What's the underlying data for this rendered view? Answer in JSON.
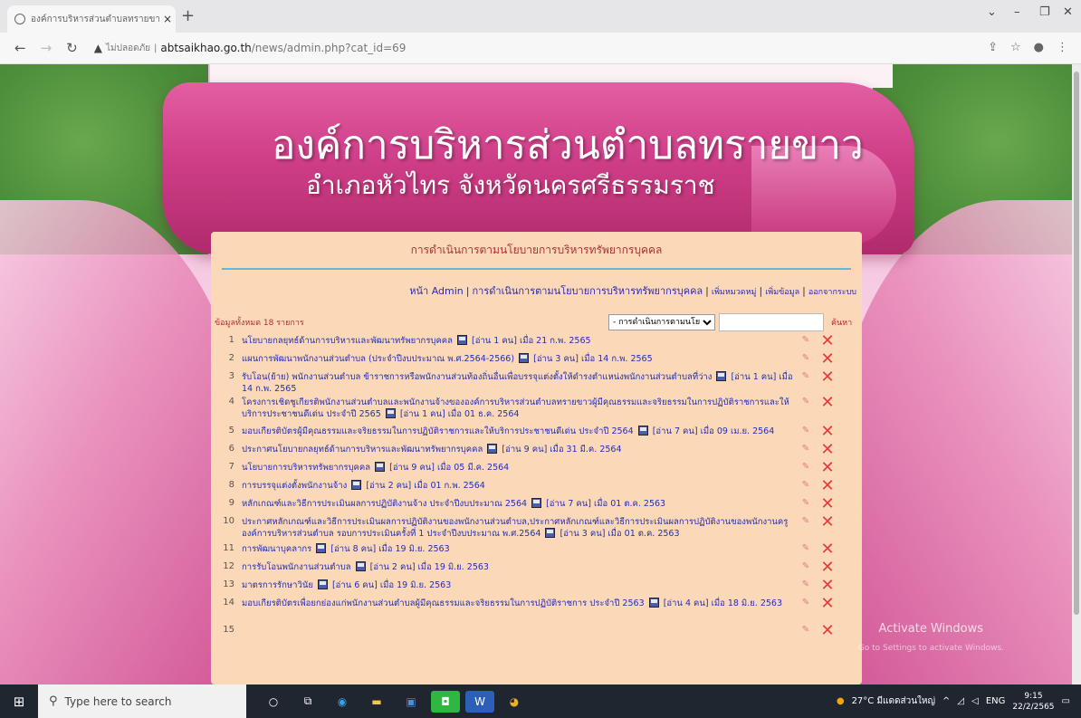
{
  "browser": {
    "tab_title": "องค์การบริหารส่วนตำบลทรายขาว อ.",
    "tab_close": "×",
    "new_tab": "+",
    "not_secure": "ไม่ปลอดภัย",
    "url_domain": "abtsaikhao.go.th",
    "url_path": "/news/admin.php?cat_id=69"
  },
  "header": {
    "org_name": "องค์การบริหารส่วนตำบลทรายขาว",
    "org_location": "อำเภอหัวไทร จังหวัดนครศรีธรรมราช"
  },
  "panel": {
    "title": "การดำเนินการตามนโยบายการบริหารทรัพยากรบุคคล",
    "nav": {
      "admin_home": "หน้า Admin",
      "category": "การดำเนินการตามนโยบายการบริหารทรัพยากรบุคคล",
      "add_category": "เพิ่มหมวดหมู่",
      "add_item": "เพิ่มข้อมูล",
      "logout": "ออกจากระบบ"
    },
    "total": "ข้อมูลทั้งหมด 18 รายการ",
    "category_select": "- การดำเนินการตามนโย",
    "search_value": "",
    "search_button": "ค้นหา",
    "items": [
      {
        "num": "1",
        "title": "นโยบายกลยุทธ์ด้านการบริหารและพัฒนาทรัพยากรบุคคล",
        "read": "[อ่าน 1 คน] เมื่อ 21 ก.พ. 2565"
      },
      {
        "num": "2",
        "title": "แผนการพัฒนาพนักงานส่วนตำบล (ประจำปีงบประมาณ พ.ศ.2564-2566)",
        "read": "[อ่าน 3 คน] เมื่อ 14 ก.พ. 2565"
      },
      {
        "num": "3",
        "title": "รับโอน(ย้าย) พนักงานส่วนตำบล ข้าราชการหรือพนักงานส่วนท้องถิ่นอื่นเพื่อบรรจุแต่งตั้งให้ดำรงตำแหน่งพนักงานส่วนตำบลที่ว่าง",
        "read": "[อ่าน 1 คน] เมื่อ 14 ก.พ. 2565"
      },
      {
        "num": "4",
        "title": "โครงการเชิดชูเกียรติพนักงานส่วนตำบลและพนักงานจ้างขององค์การบริหารส่วนตำบลทรายขาวผู้มีคุณธรรมและจริยธรรมในการปฏิบัติราชการและให้บริการประชาชนดีเด่น ประจำปี 2565",
        "read": "[อ่าน 1 คน] เมื่อ 01 ธ.ค. 2564"
      },
      {
        "num": "5",
        "title": "มอบเกียรติบัตรผู้มีคุณธรรมและจริยธรรมในการปฏิบัติราชการและให้บริการประชาชนดีเด่น ประจำปี 2564",
        "read": "[อ่าน 7 คน] เมื่อ 09 เม.ย. 2564"
      },
      {
        "num": "6",
        "title": "ประกาศนโยบายกลยุทธ์ด้านการบริหารและพัฒนาทรัพยากรบุคคล",
        "read": "[อ่าน 9 คน] เมื่อ 31 มี.ค. 2564"
      },
      {
        "num": "7",
        "title": "นโยบายการบริหารทรัพยากรบุคคล",
        "read": "[อ่าน 9 คน] เมื่อ 05 มี.ค. 2564"
      },
      {
        "num": "8",
        "title": "การบรรจุแต่งตั้งพนักงานจ้าง",
        "read": "[อ่าน 2 คน] เมื่อ 01 ก.พ. 2564"
      },
      {
        "num": "9",
        "title": "หลักเกณฑ์และวิธีการประเมินผลการปฏิบัติงานจ้าง ประจำปีงบประมาณ 2564",
        "read": "[อ่าน 7 คน] เมื่อ 01 ต.ค. 2563"
      },
      {
        "num": "10",
        "title": "ประกาศหลักเกณฑ์และวิธีการประเมินผลการปฏิบัติงานของพนักงานส่วนตำบล,ประกาศหลักเกณฑ์และวิธีการประเมินผลการปฏิบัติงานของพนักงานครูองค์การบริหารส่วนตำบล รอบการประเมินครั้งที่ 1 ประจำปีงบประมาณ พ.ศ.2564",
        "read": "[อ่าน 3 คน] เมื่อ 01 ต.ค. 2563"
      },
      {
        "num": "11",
        "title": "การพัฒนาบุคลากร",
        "read": "[อ่าน 8 คน] เมื่อ 19 มิ.ย. 2563"
      },
      {
        "num": "12",
        "title": "การรับโอนพนักงานส่วนตำบล",
        "read": "[อ่าน 2 คน] เมื่อ 19 มิ.ย. 2563"
      },
      {
        "num": "13",
        "title": "มาตรการรักษาวินัย",
        "read": "[อ่าน 6 คน] เมื่อ 19 มิ.ย. 2563"
      },
      {
        "num": "14",
        "title": "มอบเกียรติบัตรเพื่อยกย่องแก่พนักงานส่วนตำบลผู้มีคุณธรรมและจริยธรรมในการปฏิบัติราชการ ประจำปี 2563",
        "read": "[อ่าน 4 คน] เมื่อ 18 มิ.ย. 2563"
      },
      {
        "num": "15",
        "title": "",
        "read": ""
      }
    ]
  },
  "watermark": {
    "title": "Activate Windows",
    "subtitle": "Go to Settings to activate Windows."
  },
  "taskbar": {
    "search_placeholder": "Type here to search",
    "weather": "27°C มีแดดส่วนใหญ่",
    "language": "ENG",
    "time": "9:15",
    "date": "22/2/2565"
  }
}
